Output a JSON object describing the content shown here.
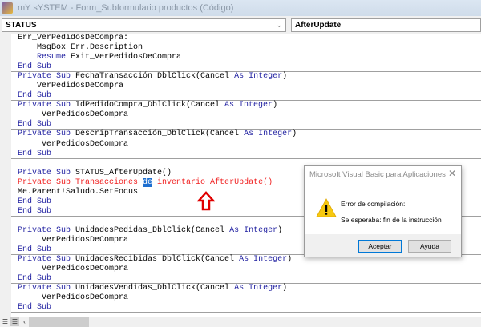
{
  "window": {
    "title": "mY sYSTEM - Form_Subformulario productos (Código)"
  },
  "toolbar": {
    "object": "STATUS",
    "procedure": "AfterUpdate"
  },
  "code_lines": [
    {
      "segs": [
        {
          "t": "Err_VerPedidosDeCompra:",
          "c": ""
        }
      ]
    },
    {
      "segs": [
        {
          "t": "    MsgBox Err.Description",
          "c": ""
        }
      ]
    },
    {
      "segs": [
        {
          "t": "    ",
          "c": ""
        },
        {
          "t": "Resume",
          "c": "kw"
        },
        {
          "t": " Exit_VerPedidosDeCompra",
          "c": ""
        }
      ]
    },
    {
      "sep": true,
      "segs": [
        {
          "t": "End Sub",
          "c": "kw"
        }
      ]
    },
    {
      "segs": [
        {
          "t": "Private Sub",
          "c": "kw"
        },
        {
          "t": " FechaTransacción_DblClick(Cancel ",
          "c": ""
        },
        {
          "t": "As Integer",
          "c": "kw"
        },
        {
          "t": ")",
          "c": ""
        }
      ]
    },
    {
      "segs": [
        {
          "t": "    VerPedidosDeCompra",
          "c": ""
        }
      ]
    },
    {
      "sep": true,
      "segs": [
        {
          "t": "End Sub",
          "c": "kw"
        }
      ]
    },
    {
      "segs": [
        {
          "t": "Private Sub",
          "c": "kw"
        },
        {
          "t": " IdPedidoCompra_DblClick(Cancel ",
          "c": ""
        },
        {
          "t": "As Integer",
          "c": "kw"
        },
        {
          "t": ")",
          "c": ""
        }
      ]
    },
    {
      "segs": [
        {
          "t": "     VerPedidosDeCompra",
          "c": ""
        }
      ]
    },
    {
      "sep": true,
      "segs": [
        {
          "t": "End Sub",
          "c": "kw"
        }
      ]
    },
    {
      "segs": [
        {
          "t": "Private Sub",
          "c": "kw"
        },
        {
          "t": " DescripTransacción_DblClick(Cancel ",
          "c": ""
        },
        {
          "t": "As Integer",
          "c": "kw"
        },
        {
          "t": ")",
          "c": ""
        }
      ]
    },
    {
      "segs": [
        {
          "t": "     VerPedidosDeCompra",
          "c": ""
        }
      ]
    },
    {
      "sep": true,
      "segs": [
        {
          "t": "End Sub",
          "c": "kw"
        }
      ]
    },
    {
      "segs": [
        {
          "t": "",
          "c": ""
        }
      ]
    },
    {
      "segs": [
        {
          "t": "Private Sub",
          "c": "kw"
        },
        {
          "t": " STATUS_AfterUpdate()",
          "c": ""
        }
      ]
    },
    {
      "segs": [
        {
          "t": "Private Sub Transacciones ",
          "c": "err"
        },
        {
          "t": "de",
          "c": "sel"
        },
        {
          "t": " inventario AfterUpdate()",
          "c": "err"
        }
      ]
    },
    {
      "segs": [
        {
          "t": "Me.Parent!Saludo.SetFocus",
          "c": ""
        }
      ]
    },
    {
      "segs": [
        {
          "t": "End Sub",
          "c": "kw"
        }
      ]
    },
    {
      "sep": true,
      "segs": [
        {
          "t": "End Sub",
          "c": "kw"
        }
      ]
    },
    {
      "segs": [
        {
          "t": "",
          "c": ""
        }
      ]
    },
    {
      "segs": [
        {
          "t": "Private Sub",
          "c": "kw"
        },
        {
          "t": " UnidadesPedidas_DblClick(Cancel ",
          "c": ""
        },
        {
          "t": "As Integer",
          "c": "kw"
        },
        {
          "t": ")",
          "c": ""
        }
      ]
    },
    {
      "segs": [
        {
          "t": "     VerPedidosDeCompra",
          "c": ""
        }
      ]
    },
    {
      "sep": true,
      "segs": [
        {
          "t": "End Sub",
          "c": "kw"
        }
      ]
    },
    {
      "segs": [
        {
          "t": "Private Sub",
          "c": "kw"
        },
        {
          "t": " UnidadesRecibidas_DblClick(Cancel ",
          "c": ""
        },
        {
          "t": "As Integer",
          "c": "kw"
        },
        {
          "t": ")",
          "c": ""
        }
      ]
    },
    {
      "segs": [
        {
          "t": "     VerPedidosDeCompra",
          "c": ""
        }
      ]
    },
    {
      "sep": true,
      "segs": [
        {
          "t": "End Sub",
          "c": "kw"
        }
      ]
    },
    {
      "segs": [
        {
          "t": "Private Sub",
          "c": "kw"
        },
        {
          "t": " UnidadesVendidas_DblClick(Cancel ",
          "c": ""
        },
        {
          "t": "As Integer",
          "c": "kw"
        },
        {
          "t": ")",
          "c": ""
        }
      ]
    },
    {
      "segs": [
        {
          "t": "     VerPedidosDeCompra",
          "c": ""
        }
      ]
    },
    {
      "sep": true,
      "segs": [
        {
          "t": "End Sub",
          "c": "kw"
        }
      ]
    }
  ],
  "dialog": {
    "title": "Microsoft Visual Basic para Aplicaciones",
    "close": "✕",
    "message_title": "Error de compilación:",
    "message": "Se esperaba: fin de la instrucción",
    "ok_label": "Aceptar",
    "help_label": "Ayuda"
  },
  "icons": {
    "chevron": "⌄",
    "scroll_left": "‹"
  }
}
